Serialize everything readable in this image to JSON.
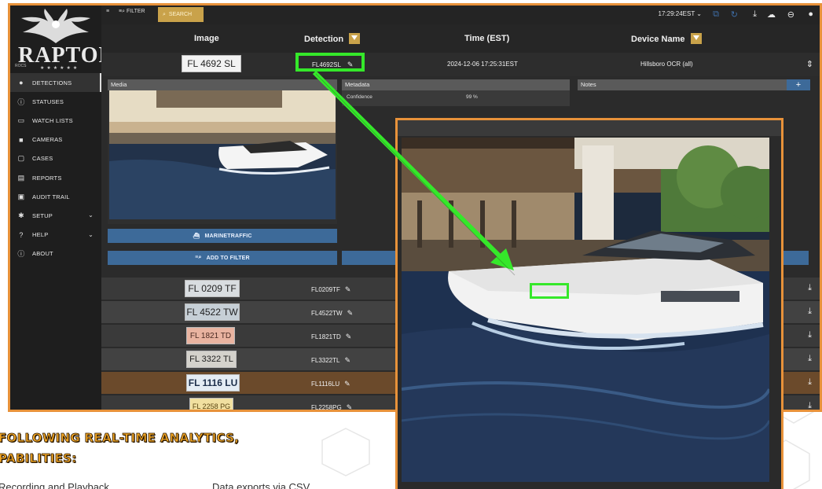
{
  "brand": {
    "name": "RAPTOR",
    "tagline": "ROCS"
  },
  "colors": {
    "accent": "#e8923a",
    "filter": "#c9a24a",
    "highlight": "#35e82a",
    "button": "#3d6a99"
  },
  "nav": [
    {
      "label": "DETECTIONS",
      "icon": "pin-icon",
      "active": true
    },
    {
      "label": "STATUSES",
      "icon": "info-icon"
    },
    {
      "label": "WATCH LISTS",
      "icon": "list-box-icon"
    },
    {
      "label": "CAMERAS",
      "icon": "camera-icon"
    },
    {
      "label": "CASES",
      "icon": "clipboard-icon"
    },
    {
      "label": "REPORTS",
      "icon": "report-icon"
    },
    {
      "label": "AUDIT TRAIL",
      "icon": "briefcase-icon"
    },
    {
      "label": "SETUP",
      "icon": "gear-icon",
      "chevron": true
    },
    {
      "label": "HELP",
      "icon": "help-icon",
      "chevron": true
    },
    {
      "label": "ABOUT",
      "icon": "info-icon"
    }
  ],
  "toolbar": {
    "collapse": "≡",
    "filter_label": "FILTER",
    "search_label": "SEARCH",
    "clock": "17:29:24EST"
  },
  "columns": {
    "image": "Image",
    "detection": "Detection",
    "time": "Time (EST)",
    "device": "Device Name"
  },
  "expanded": {
    "plate": "FL 4692 SL",
    "detection": "FL4692SL",
    "time": "2024-12-06 17:25:31EST",
    "device": "Hillsboro OCR (all)",
    "media_label": "Media",
    "metadata_label": "Metadata",
    "notes_label": "Notes",
    "confidence_label": "Confidence",
    "confidence_value": "99 %",
    "marinetraffic_label": "MARINETRAFFIC",
    "add_filter_label": "ADD TO FILTER"
  },
  "rows": [
    {
      "plate": "FL 0209 TF",
      "detection": "FL0209TF"
    },
    {
      "plate": "FL 4522 TW",
      "detection": "FL4522TW"
    },
    {
      "plate": "FL 1821 TD",
      "detection": "FL1821TD"
    },
    {
      "plate": "FL 3322 TL",
      "detection": "FL3322TL"
    },
    {
      "plate": "FL 1116 LU",
      "detection": "FL1116LU",
      "selected": true
    },
    {
      "plate": "FL 2258 PG",
      "detection": "FL2258PG"
    }
  ],
  "marketing": {
    "heading_line1": "FOLLOWING REAL-TIME ANALYTICS,",
    "heading_line2": "PABILITIES:",
    "item1": "Recording and Playback",
    "item2": "Data exports via CSV"
  }
}
